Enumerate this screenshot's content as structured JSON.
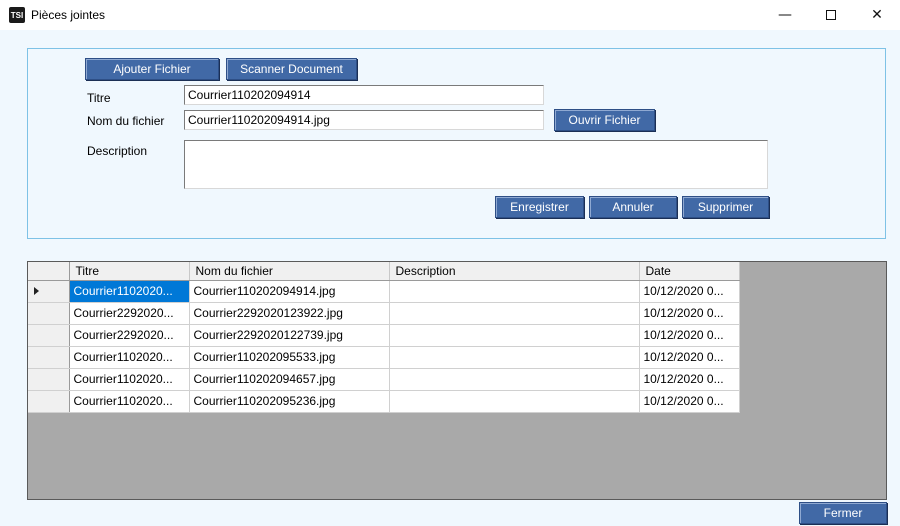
{
  "window": {
    "icon_text": "TSI",
    "title": "Pièces jointes",
    "minimize_glyph": "—",
    "close_glyph": "✕"
  },
  "form": {
    "add_file_label": "Ajouter Fichier",
    "scan_label": "Scanner Document",
    "title_label": "Titre",
    "title_value": "Courrier110202094914",
    "filename_label": "Nom du fichier",
    "filename_value": "Courrier110202094914.jpg",
    "open_file_label": "Ouvrir Fichier",
    "description_label": "Description",
    "description_value": "",
    "save_label": "Enregistrer",
    "cancel_label": "Annuler",
    "delete_label": "Supprimer"
  },
  "grid": {
    "columns": [
      "Titre",
      "Nom du fichier",
      "Description",
      "Date"
    ],
    "rows": [
      {
        "titre": "Courrier1102020...",
        "fichier": "Courrier110202094914.jpg",
        "description": "",
        "date": "10/12/2020 0...",
        "selected": true
      },
      {
        "titre": "Courrier2292020...",
        "fichier": "Courrier2292020123922.jpg",
        "description": "",
        "date": "10/12/2020 0...",
        "selected": false
      },
      {
        "titre": "Courrier2292020...",
        "fichier": "Courrier2292020122739.jpg",
        "description": "",
        "date": "10/12/2020 0...",
        "selected": false
      },
      {
        "titre": "Courrier1102020...",
        "fichier": "Courrier110202095533.jpg",
        "description": "",
        "date": "10/12/2020 0...",
        "selected": false
      },
      {
        "titre": "Courrier1102020...",
        "fichier": "Courrier110202094657.jpg",
        "description": "",
        "date": "10/12/2020 0...",
        "selected": false
      },
      {
        "titre": "Courrier1102020...",
        "fichier": "Courrier110202095236.jpg",
        "description": "",
        "date": "10/12/2020 0...",
        "selected": false
      }
    ]
  },
  "footer": {
    "close_label": "Fermer"
  },
  "colors": {
    "button_blue": "#4169A6",
    "selection_blue": "#0078D7",
    "panel_border": "#7EC2E6",
    "window_bg": "#F0F8FE"
  }
}
